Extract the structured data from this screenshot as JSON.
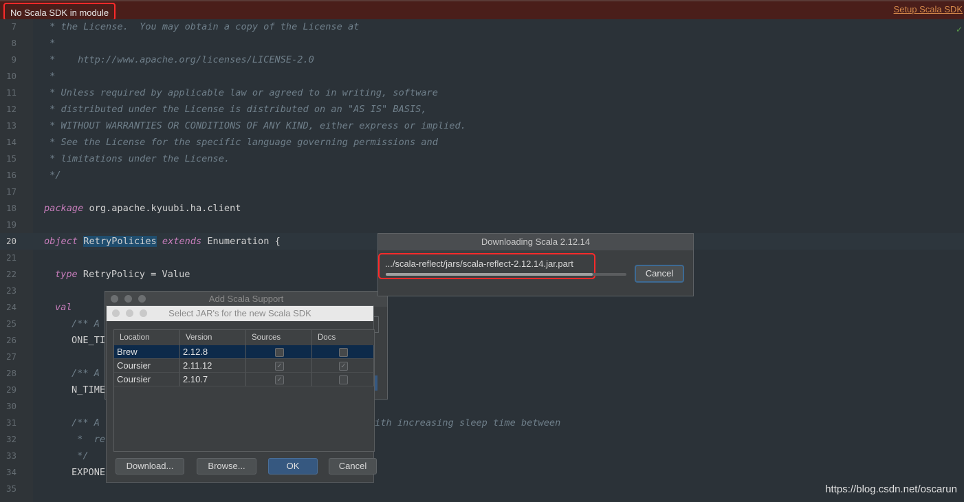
{
  "banner": {
    "message": "No Scala SDK in module",
    "link": "Setup Scala SDK"
  },
  "editor": {
    "current_line": "20",
    "lines": [
      {
        "n": "7",
        "top": 0
      },
      {
        "n": "8"
      },
      {
        "n": "9"
      },
      {
        "n": "10"
      },
      {
        "n": "11"
      },
      {
        "n": "12"
      },
      {
        "n": "13"
      },
      {
        "n": "14"
      },
      {
        "n": "15"
      },
      {
        "n": "16"
      },
      {
        "n": "17"
      },
      {
        "n": "18"
      },
      {
        "n": "19"
      },
      {
        "n": "20"
      },
      {
        "n": "21"
      },
      {
        "n": "22"
      },
      {
        "n": "23"
      },
      {
        "n": "24"
      },
      {
        "n": "25"
      },
      {
        "n": "26"
      },
      {
        "n": "27"
      },
      {
        "n": "28"
      },
      {
        "n": "29"
      },
      {
        "n": "30"
      },
      {
        "n": "31"
      },
      {
        "n": "32"
      },
      {
        "n": "33"
      },
      {
        "n": "34"
      },
      {
        "n": "35"
      }
    ],
    "code": {
      "l7": " * the License.  You may obtain a copy of the License at",
      "l8": " *",
      "l9": " *    http://www.apache.org/licenses/LICENSE-2.0",
      "l10": " *",
      "l11": " * Unless required by applicable law or agreed to in writing, software",
      "l12": " * distributed under the License is distributed on an \"AS IS\" BASIS,",
      "l13": " * WITHOUT WARRANTIES OR CONDITIONS OF ANY KIND, either express or implied.",
      "l14": " * See the License for the specific language governing permissions and",
      "l15": " * limitations under the License.",
      "l16": " */",
      "l18_kw": "package",
      "l18_rest": " org.apache.kyuubi.ha.client",
      "l20_kw": "object",
      "l20_name": "RetryPolicies",
      "l20_kw2": "extends",
      "l20_rest": " Enumeration {",
      "l22_kw": "type",
      "l22_rest": " RetryPolicy = Value",
      "l24_kw": "val",
      "l25": "/** A",
      "l26": "ONE_TI",
      "l28": "/** A",
      "l29": "N_TIME",
      "l31_a": "/** A",
      "l31_b": "with increasing sleep time between",
      "l32": " *  re",
      "l33": " */",
      "l34": "EXPONE"
    }
  },
  "download_dialog": {
    "title": "Downloading Scala 2.12.14",
    "path": ".../scala-reflect/jars/scala-reflect-2.12.14.jar.part",
    "progress": 0.86,
    "cancel": "Cancel"
  },
  "add_dialog": {
    "title": "Add Scala Support"
  },
  "jar_dialog": {
    "title": "Select JAR's for the new Scala SDK",
    "columns": [
      "Location",
      "Version",
      "Sources",
      "Docs"
    ],
    "rows": [
      {
        "location": "Brew",
        "version": "2.12.8",
        "sources": false,
        "docs": false,
        "selected": true
      },
      {
        "location": "Coursier",
        "version": "2.11.12",
        "sources": true,
        "docs": true,
        "selected": false
      },
      {
        "location": "Coursier",
        "version": "2.10.7",
        "sources": true,
        "docs": false,
        "selected": false
      }
    ],
    "buttons": {
      "download": "Download...",
      "browse": "Browse...",
      "ok": "OK",
      "cancel": "Cancel"
    }
  },
  "watermark": "https://blog.csdn.net/oscarun"
}
